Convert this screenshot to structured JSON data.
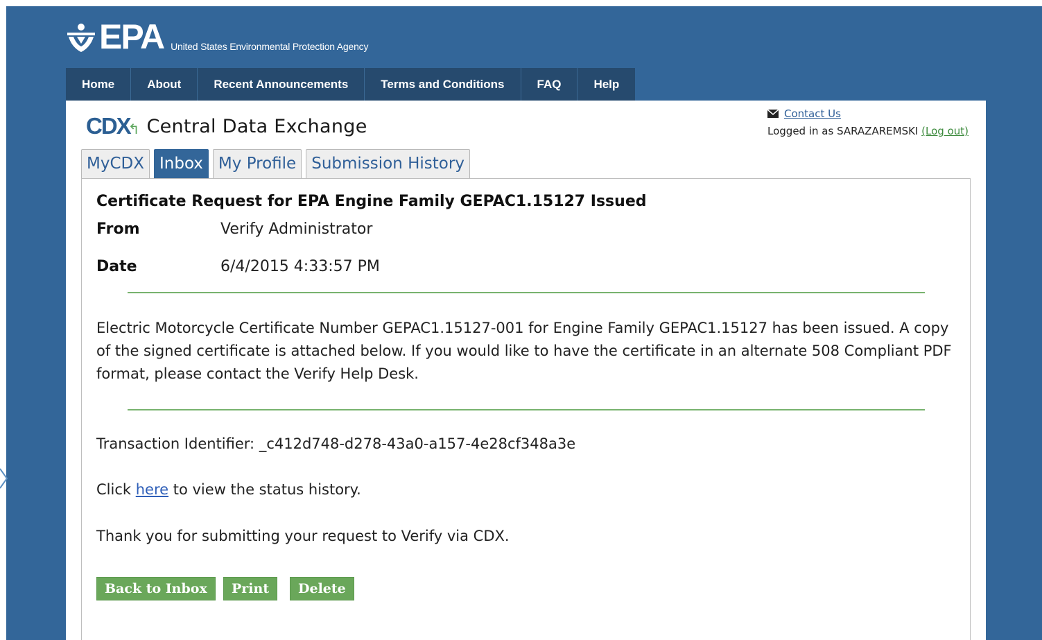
{
  "header": {
    "logo_text": "EPA",
    "agency_name": "United States Environmental Protection Agency"
  },
  "topnav": {
    "items": [
      "Home",
      "About",
      "Recent Announcements",
      "Terms and Conditions",
      "FAQ",
      "Help"
    ]
  },
  "app": {
    "logo_mark": "CDX",
    "title": "Central Data Exchange"
  },
  "user": {
    "contact_label": "Contact Us",
    "logged_in_prefix": "Logged in as",
    "username": "SARAZAREMSKI",
    "logout_label": "(Log out)"
  },
  "tabs": [
    {
      "label": "MyCDX",
      "active": false
    },
    {
      "label": "Inbox",
      "active": true
    },
    {
      "label": "My Profile",
      "active": false
    },
    {
      "label": "Submission History",
      "active": false
    }
  ],
  "message": {
    "subject": "Certificate Request for EPA Engine Family GEPAC1.15127 Issued",
    "from_label": "From",
    "from_value": "Verify Administrator",
    "date_label": "Date",
    "date_value": "6/4/2015 4:33:57 PM",
    "body": "Electric Motorcycle Certificate Number GEPAC1.15127-001 for Engine Family GEPAC1.15127 has been issued. A copy of the signed certificate is attached below. If you would like to have the certificate in an alternate 508 Compliant PDF format, please contact the Verify Help Desk.",
    "transaction_label": "Transaction Identifier:",
    "transaction_id": "_c412d748-d278-43a0-a157-4e28cf348a3e",
    "click_prefix": "Click",
    "click_link": "here",
    "click_suffix": "to view the status history.",
    "thanks": "Thank you for submitting your request to Verify via CDX."
  },
  "buttons": {
    "back": "Back to Inbox",
    "print": "Print",
    "delete": "Delete"
  },
  "colors": {
    "page_blue": "#336699",
    "nav_dark": "#264a6e",
    "button_green": "#6aa75a",
    "divider_green": "#78b36e",
    "link_blue": "#2f5fb8"
  },
  "icons": {
    "mail": "envelope-icon",
    "epa_flower": "epa-flower-icon",
    "cdx_arrow": "cdx-arrow-icon"
  }
}
